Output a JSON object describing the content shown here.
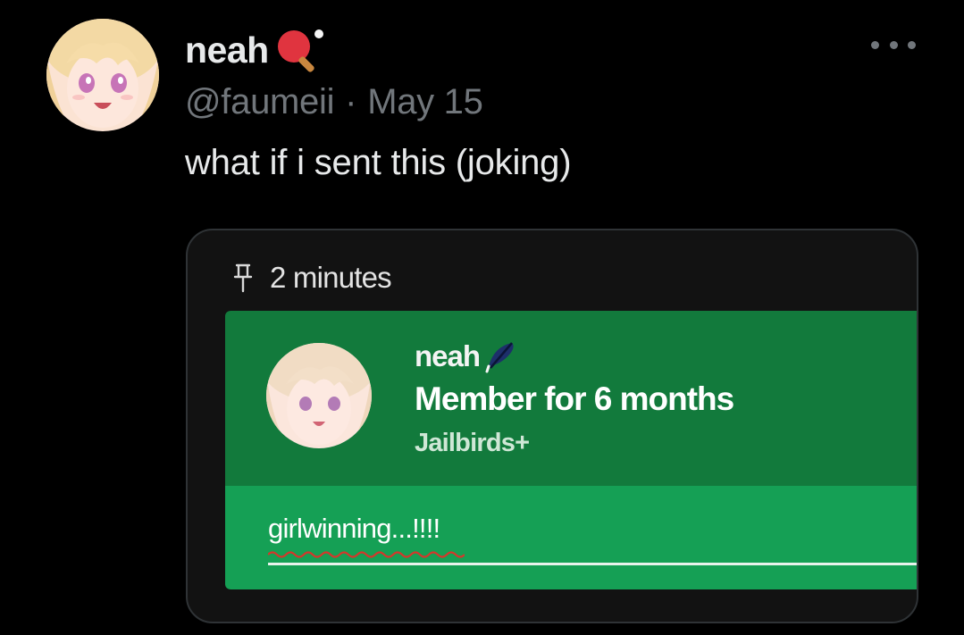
{
  "tweet": {
    "display_name": "neah",
    "handle": "@faumeii",
    "separator": "·",
    "date": "May 15",
    "text": "what if i sent this (joking)",
    "name_emoji": "ping-pong-icon",
    "more_icon": "more-dots-icon"
  },
  "media": {
    "pin_icon": "pin-icon",
    "pin_label": "2 minutes",
    "member": {
      "name": "neah",
      "name_icon": "feather-icon",
      "duration": "Member for 6 months",
      "role": "Jailbirds+"
    },
    "input_value": "girlwinning...!!!!"
  },
  "colors": {
    "background": "#000000",
    "text_primary": "#e7e9ea",
    "text_secondary": "#71767b",
    "panel_dark_green": "#127a3c",
    "panel_light_green": "#15a055",
    "spellcheck_red": "#d6362b"
  }
}
